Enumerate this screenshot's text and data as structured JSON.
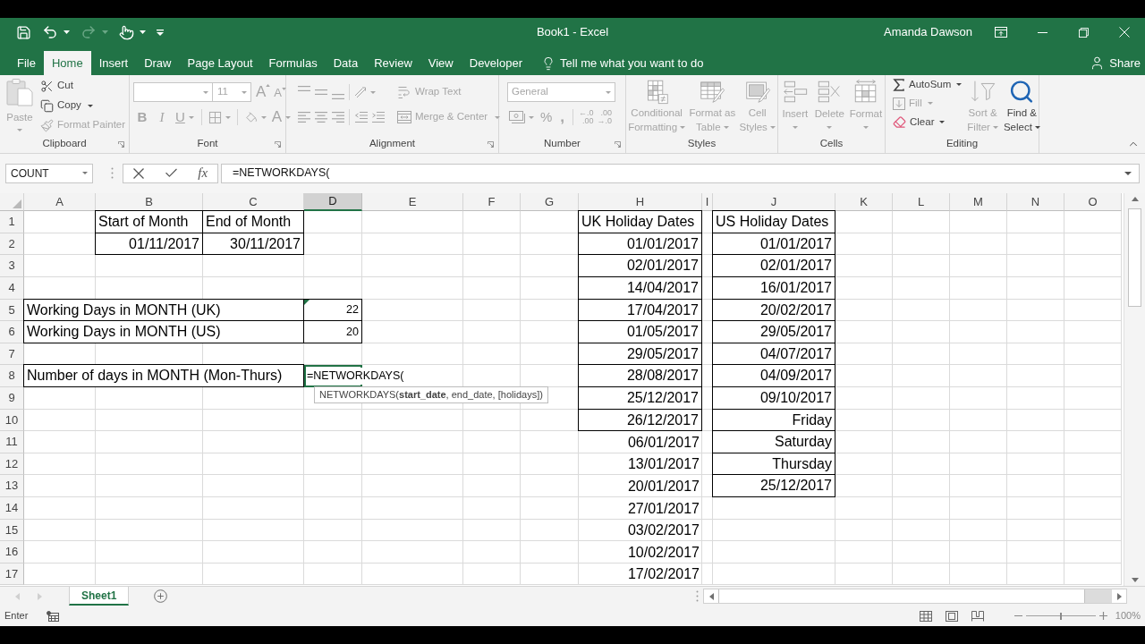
{
  "window": {
    "title": "Book1 - Excel",
    "user": "Amanda Dawson"
  },
  "quick_access": [
    {
      "kind": "save",
      "disabled": false
    },
    {
      "kind": "undo",
      "disabled": false
    },
    {
      "kind": "redo",
      "disabled": true
    },
    {
      "kind": "touch",
      "disabled": false
    },
    {
      "kind": "customize",
      "disabled": false
    }
  ],
  "ribbon_tabs": [
    {
      "label": "File",
      "selected": false
    },
    {
      "label": "Home",
      "selected": true
    },
    {
      "label": "Insert",
      "selected": false
    },
    {
      "label": "Draw",
      "selected": false
    },
    {
      "label": "Page Layout",
      "selected": false
    },
    {
      "label": "Formulas",
      "selected": false
    },
    {
      "label": "Data",
      "selected": false
    },
    {
      "label": "Review",
      "selected": false
    },
    {
      "label": "View",
      "selected": false
    },
    {
      "label": "Developer",
      "selected": false
    }
  ],
  "tell_me": "Tell me what you want to do",
  "share": "Share",
  "ribbon": {
    "clipboard": {
      "label": "Clipboard",
      "paste": {
        "label": "Paste",
        "disabled": true
      },
      "small": [
        {
          "kind": "cut",
          "label": "Cut",
          "disabled": false
        },
        {
          "kind": "copy",
          "label": "Copy",
          "disabled": false
        },
        {
          "kind": "format_painter",
          "label": "Format Painter",
          "disabled": true
        }
      ]
    },
    "font": {
      "label": "Font",
      "size": "11",
      "grow": "A",
      "shrink": "A",
      "styles": [
        "B",
        "I",
        "U"
      ],
      "font_color": "A",
      "disabled": true
    },
    "alignment": {
      "label": "Alignment",
      "wrap_text": "Wrap Text",
      "merge": "Merge & Center",
      "disabled": true
    },
    "number": {
      "label": "Number",
      "format": "General",
      "percent": "%",
      "comma": ",",
      "decrease_decimal": [
        "←.0",
        ".00"
      ],
      "increase_decimal": [
        ".00",
        "→.0"
      ],
      "disabled": true
    },
    "styles": {
      "label": "Styles",
      "buttons": [
        {
          "kind": "conditional",
          "lines": [
            "Conditional",
            "Formatting"
          ],
          "disabled": true
        },
        {
          "kind": "table",
          "lines": [
            "Format as",
            "Table"
          ],
          "disabled": true
        },
        {
          "kind": "cell_styles",
          "lines": [
            "Cell",
            "Styles"
          ],
          "disabled": true
        }
      ]
    },
    "cells": {
      "label": "Cells",
      "buttons": [
        {
          "kind": "insert",
          "lines": [
            "Insert"
          ],
          "disabled": true
        },
        {
          "kind": "delete",
          "lines": [
            "Delete"
          ],
          "disabled": true
        },
        {
          "kind": "format",
          "lines": [
            "Format"
          ],
          "disabled": true
        }
      ]
    },
    "editing": {
      "label": "Editing",
      "small": [
        {
          "kind": "autosum",
          "label": "AutoSum",
          "disabled": false
        },
        {
          "kind": "fill",
          "label": "Fill",
          "disabled": true
        },
        {
          "kind": "clear",
          "label": "Clear",
          "disabled": false
        }
      ],
      "large": [
        {
          "kind": "sort",
          "lines": [
            "Sort &",
            "Filter"
          ],
          "disabled": true
        },
        {
          "kind": "find",
          "lines": [
            "Find &",
            "Select"
          ],
          "disabled": false
        }
      ]
    }
  },
  "formula_bar": {
    "name_box": "COUNT",
    "function_button": "fx",
    "formula": "=NETWORKDAYS("
  },
  "sheet": {
    "columns": [
      {
        "label": "A",
        "selected": false
      },
      {
        "label": "B",
        "selected": false
      },
      {
        "label": "C",
        "selected": false
      },
      {
        "label": "D",
        "selected": true
      },
      {
        "label": "E",
        "selected": false
      },
      {
        "label": "F",
        "selected": false
      },
      {
        "label": "G",
        "selected": false
      },
      {
        "label": "H",
        "selected": false
      },
      {
        "label": "I",
        "selected": false
      },
      {
        "label": "J",
        "selected": false
      },
      {
        "label": "K",
        "selected": false
      },
      {
        "label": "L",
        "selected": false
      },
      {
        "label": "M",
        "selected": false
      },
      {
        "label": "N",
        "selected": false
      },
      {
        "label": "O",
        "selected": false
      }
    ],
    "rows": [
      {
        "label": "1",
        "selected": false,
        "cells": [
          null,
          {
            "text": "Start of Month",
            "kind": "text",
            "bordered": true,
            "spills_right": false,
            "active": false,
            "flag": false
          },
          {
            "text": "End of Month",
            "kind": "text",
            "bordered": true,
            "spills_right": false,
            "active": false,
            "flag": false
          },
          null,
          null,
          null,
          null,
          {
            "text": "UK Holiday Dates",
            "kind": "text",
            "bordered": true,
            "spills_right": false,
            "active": false,
            "flag": false
          },
          null,
          {
            "text": "US Holiday Dates",
            "kind": "text",
            "bordered": true,
            "spills_right": false,
            "active": false,
            "flag": false
          },
          null,
          null,
          null,
          null,
          null
        ]
      },
      {
        "label": "2",
        "selected": false,
        "cells": [
          null,
          {
            "text": "01/11/2017",
            "kind": "value",
            "bordered": true,
            "spills_right": false,
            "active": false,
            "flag": false
          },
          {
            "text": "30/11/2017",
            "kind": "value",
            "bordered": true,
            "spills_right": false,
            "active": false,
            "flag": false
          },
          null,
          null,
          null,
          null,
          {
            "text": "01/01/2017",
            "kind": "value",
            "bordered": true,
            "spills_right": false,
            "active": false,
            "flag": false
          },
          null,
          {
            "text": "01/01/2017",
            "kind": "value",
            "bordered": true,
            "spills_right": false,
            "active": false,
            "flag": false
          },
          null,
          null,
          null,
          null,
          null
        ]
      },
      {
        "label": "3",
        "selected": false,
        "cells": [
          null,
          null,
          null,
          null,
          null,
          null,
          null,
          {
            "text": "02/01/2017",
            "kind": "value",
            "bordered": true,
            "spills_right": false,
            "active": false,
            "flag": false
          },
          null,
          {
            "text": "02/01/2017",
            "kind": "value",
            "bordered": true,
            "spills_right": false,
            "active": false,
            "flag": false
          },
          null,
          null,
          null,
          null,
          null
        ]
      },
      {
        "label": "4",
        "selected": false,
        "cells": [
          null,
          null,
          null,
          null,
          null,
          null,
          null,
          {
            "text": "14/04/2017",
            "kind": "value",
            "bordered": true,
            "spills_right": false,
            "active": false,
            "flag": false
          },
          null,
          {
            "text": "16/01/2017",
            "kind": "value",
            "bordered": true,
            "spills_right": false,
            "active": false,
            "flag": false
          },
          null,
          null,
          null,
          null,
          null
        ]
      },
      {
        "label": "5",
        "selected": false,
        "cells": [
          {
            "text": "Working Days in MONTH (UK)",
            "kind": "text",
            "bordered": true,
            "spills_right": true,
            "active": false,
            "flag": false
          },
          null,
          null,
          {
            "text": "22",
            "kind": "number",
            "bordered": true,
            "spills_right": false,
            "active": false,
            "flag": true
          },
          null,
          null,
          null,
          {
            "text": "17/04/2017",
            "kind": "value",
            "bordered": true,
            "spills_right": false,
            "active": false,
            "flag": false
          },
          null,
          {
            "text": "20/02/2017",
            "kind": "value",
            "bordered": true,
            "spills_right": false,
            "active": false,
            "flag": false
          },
          null,
          null,
          null,
          null,
          null
        ]
      },
      {
        "label": "6",
        "selected": false,
        "cells": [
          {
            "text": "Working Days in MONTH (US)",
            "kind": "text",
            "bordered": true,
            "spills_right": true,
            "active": false,
            "flag": false
          },
          null,
          null,
          {
            "text": "20",
            "kind": "number",
            "bordered": true,
            "spills_right": false,
            "active": false,
            "flag": false
          },
          null,
          null,
          null,
          {
            "text": "01/05/2017",
            "kind": "value",
            "bordered": true,
            "spills_right": false,
            "active": false,
            "flag": false
          },
          null,
          {
            "text": "29/05/2017",
            "kind": "value",
            "bordered": true,
            "spills_right": false,
            "active": false,
            "flag": false
          },
          null,
          null,
          null,
          null,
          null
        ]
      },
      {
        "label": "7",
        "selected": false,
        "cells": [
          null,
          null,
          null,
          null,
          null,
          null,
          null,
          {
            "text": "29/05/2017",
            "kind": "value",
            "bordered": true,
            "spills_right": false,
            "active": false,
            "flag": false
          },
          null,
          {
            "text": "04/07/2017",
            "kind": "value",
            "bordered": true,
            "spills_right": false,
            "active": false,
            "flag": false
          },
          null,
          null,
          null,
          null,
          null
        ]
      },
      {
        "label": "8",
        "selected": false,
        "cells": [
          {
            "text": "Number of days in MONTH (Mon-Thurs)",
            "kind": "text",
            "bordered": true,
            "spills_right": true,
            "active": false,
            "flag": false
          },
          null,
          null,
          {
            "text": "=NETWORKDAYS(",
            "kind": "entry",
            "bordered": false,
            "spills_right": false,
            "active": true,
            "flag": false
          },
          null,
          null,
          null,
          {
            "text": "28/08/2017",
            "kind": "value",
            "bordered": true,
            "spills_right": false,
            "active": false,
            "flag": false
          },
          null,
          {
            "text": "04/09/2017",
            "kind": "value",
            "bordered": true,
            "spills_right": false,
            "active": false,
            "flag": false
          },
          null,
          null,
          null,
          null,
          null
        ]
      },
      {
        "label": "9",
        "selected": false,
        "cells": [
          null,
          null,
          null,
          null,
          null,
          null,
          null,
          {
            "text": "25/12/2017",
            "kind": "value",
            "bordered": true,
            "spills_right": false,
            "active": false,
            "flag": false
          },
          null,
          {
            "text": "09/10/2017",
            "kind": "value",
            "bordered": true,
            "spills_right": false,
            "active": false,
            "flag": false
          },
          null,
          null,
          null,
          null,
          null
        ]
      },
      {
        "label": "10",
        "selected": false,
        "cells": [
          null,
          null,
          null,
          null,
          null,
          null,
          null,
          {
            "text": "26/12/2017",
            "kind": "value",
            "bordered": true,
            "spills_right": false,
            "active": false,
            "flag": false
          },
          null,
          {
            "text": "Friday",
            "kind": "value",
            "bordered": true,
            "spills_right": false,
            "active": false,
            "flag": false
          },
          null,
          null,
          null,
          null,
          null
        ]
      },
      {
        "label": "11",
        "selected": false,
        "cells": [
          null,
          null,
          null,
          null,
          null,
          null,
          null,
          {
            "text": "06/01/2017",
            "kind": "value",
            "bordered": false,
            "spills_right": false,
            "active": false,
            "flag": false
          },
          null,
          {
            "text": "Saturday",
            "kind": "value",
            "bordered": true,
            "spills_right": false,
            "active": false,
            "flag": false
          },
          null,
          null,
          null,
          null,
          null
        ]
      },
      {
        "label": "12",
        "selected": false,
        "cells": [
          null,
          null,
          null,
          null,
          null,
          null,
          null,
          {
            "text": "13/01/2017",
            "kind": "value",
            "bordered": false,
            "spills_right": false,
            "active": false,
            "flag": false
          },
          null,
          {
            "text": "Thursday",
            "kind": "value",
            "bordered": true,
            "spills_right": false,
            "active": false,
            "flag": false
          },
          null,
          null,
          null,
          null,
          null
        ]
      },
      {
        "label": "13",
        "selected": false,
        "cells": [
          null,
          null,
          null,
          null,
          null,
          null,
          null,
          {
            "text": "20/01/2017",
            "kind": "value",
            "bordered": false,
            "spills_right": false,
            "active": false,
            "flag": false
          },
          null,
          {
            "text": "25/12/2017",
            "kind": "value",
            "bordered": true,
            "spills_right": false,
            "active": false,
            "flag": false
          },
          null,
          null,
          null,
          null,
          null
        ]
      },
      {
        "label": "14",
        "selected": false,
        "cells": [
          null,
          null,
          null,
          null,
          null,
          null,
          null,
          {
            "text": "27/01/2017",
            "kind": "value",
            "bordered": false,
            "spills_right": false,
            "active": false,
            "flag": false
          },
          null,
          null,
          null,
          null,
          null,
          null,
          null
        ]
      },
      {
        "label": "15",
        "selected": false,
        "cells": [
          null,
          null,
          null,
          null,
          null,
          null,
          null,
          {
            "text": "03/02/2017",
            "kind": "value",
            "bordered": false,
            "spills_right": false,
            "active": false,
            "flag": false
          },
          null,
          null,
          null,
          null,
          null,
          null,
          null
        ]
      },
      {
        "label": "16",
        "selected": false,
        "cells": [
          null,
          null,
          null,
          null,
          null,
          null,
          null,
          {
            "text": "10/02/2017",
            "kind": "value",
            "bordered": false,
            "spills_right": false,
            "active": false,
            "flag": false
          },
          null,
          null,
          null,
          null,
          null,
          null,
          null
        ]
      },
      {
        "label": "17",
        "selected": false,
        "cells": [
          null,
          null,
          null,
          null,
          null,
          null,
          null,
          {
            "text": "17/02/2017",
            "kind": "value",
            "bordered": false,
            "spills_right": false,
            "active": false,
            "flag": false
          },
          null,
          null,
          null,
          null,
          null,
          null,
          null
        ]
      }
    ],
    "function_tooltip": "NETWORKDAYS(**start_date**, end_date, [holidays])"
  },
  "sheet_tabs": [
    {
      "label": "Sheet1",
      "selected": true
    }
  ],
  "status_bar": {
    "mode": "Enter",
    "zoom": "100%",
    "zoom_slider": {
      "level": 0.5
    }
  }
}
